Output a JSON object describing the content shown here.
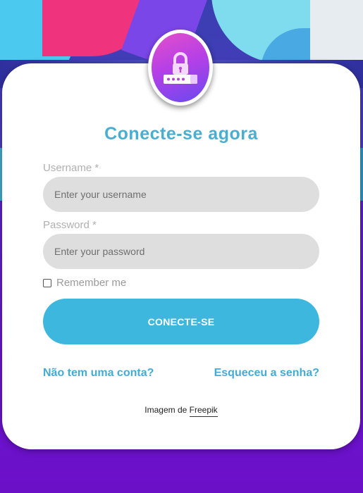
{
  "form": {
    "title": "Conecte-se agora",
    "username_label": "Username *",
    "username_placeholder": "Enter your username",
    "password_label": "Password *",
    "password_placeholder": "Enter your password",
    "remember_label": "Remember me",
    "remember_checked": false,
    "submit_label": "CONECTE-SE"
  },
  "links": {
    "signup": "Não tem uma conta?",
    "forgot": "Esqueceu a senha?"
  },
  "credit": {
    "prefix": "Imagem de",
    "link": "Freepik"
  },
  "icons": {
    "avatar": "lock-password-icon"
  },
  "colors": {
    "accent": "#3db7dd",
    "title": "#4aaed0",
    "input_bg": "#dedede"
  }
}
